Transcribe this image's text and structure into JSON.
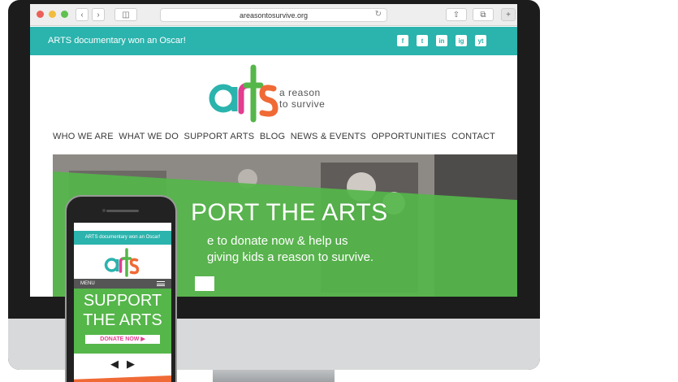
{
  "browser": {
    "url": "areasontosurvive.org",
    "back_icon": "chevron-left-icon",
    "forward_icon": "chevron-right-icon",
    "sidebar_icon": "sidebar-icon",
    "share_icon": "share-icon",
    "tabs_icon": "tabs-icon",
    "newtab_label": "+"
  },
  "topbar": {
    "news": "ARTS documentary won an Oscar!",
    "social": [
      "f",
      "t",
      "in",
      "ig",
      "yt"
    ]
  },
  "logo": {
    "wordmark": "arts",
    "tagline_line1": "a reason",
    "tagline_line2": "to survive"
  },
  "nav": {
    "items": [
      "WHO WE ARE",
      "WHAT WE DO",
      "SUPPORT ARTS",
      "BLOG",
      "NEWS & EVENTS",
      "OPPORTUNITIES",
      "CONTACT"
    ]
  },
  "hero": {
    "title": "PORT THE ARTS",
    "line1": "e to donate now & help us",
    "line2": "giving kids a reason to survive."
  },
  "phone": {
    "topbar": "ARTS documentary won an Oscar!",
    "menu": "MENU",
    "title_line1": "SUPPORT",
    "title_line2": "THE ARTS",
    "donate": "DONATE NOW ▶",
    "prev": "◀",
    "next": "▶"
  },
  "colors": {
    "teal": "#2bb3ad",
    "green": "#55b64a",
    "pink": "#e33d8f",
    "orange": "#f06a36"
  }
}
